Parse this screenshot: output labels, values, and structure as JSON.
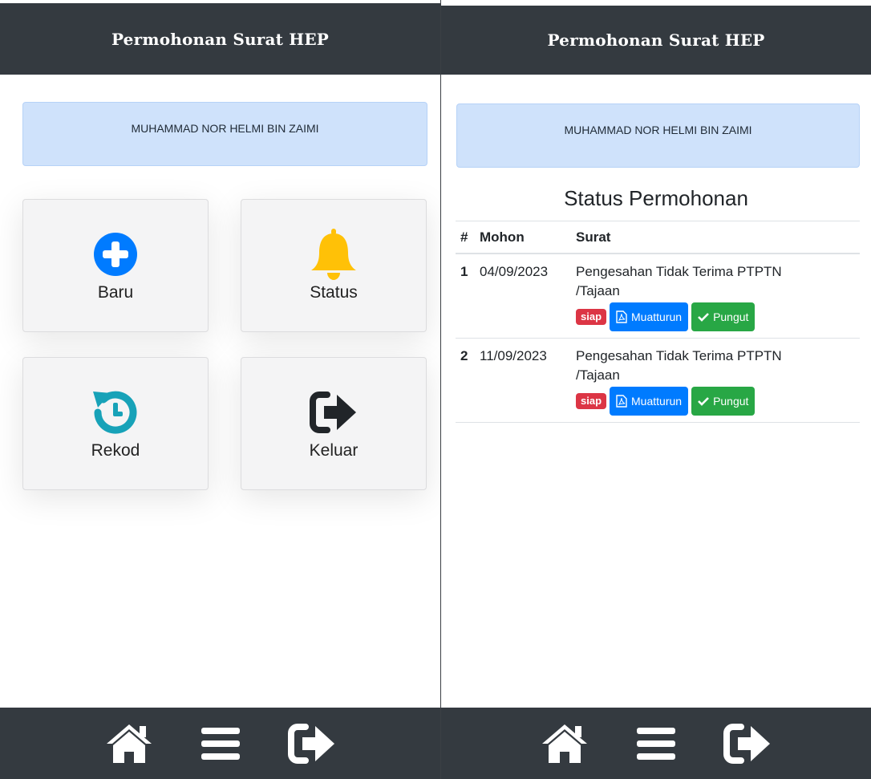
{
  "left": {
    "header": {
      "title": "Permohonan Surat HEP"
    },
    "user": {
      "name": "MUHAMMAD NOR HELMI BIN ZAIMI"
    },
    "tiles": [
      {
        "label": "Baru",
        "icon": "plus-circle-icon",
        "color": "#007bff"
      },
      {
        "label": "Status",
        "icon": "bell-icon",
        "color": "#ffc107"
      },
      {
        "label": "Rekod",
        "icon": "history-icon",
        "color": "#17a2b8"
      },
      {
        "label": "Keluar",
        "icon": "sign-out-icon",
        "color": "#212529"
      }
    ],
    "footer": {
      "icons": [
        "home-icon",
        "menu-icon",
        "sign-out-icon"
      ]
    }
  },
  "right": {
    "header": {
      "title": "Permohonan Surat HEP"
    },
    "user": {
      "name": "MUHAMMAD NOR HELMI BIN ZAIMI"
    },
    "section_title": "Status Permohonan",
    "table": {
      "headers": [
        "#",
        "Mohon",
        "Surat"
      ],
      "rows": [
        {
          "num": "1",
          "date": "04/09/2023",
          "surat_line1": "Pengesahan Tidak Terima PTPTN",
          "surat_line2": "/Tajaan",
          "badge": "siap",
          "download": "Muatturun",
          "collect": "Pungut"
        },
        {
          "num": "2",
          "date": "11/09/2023",
          "surat_line1": "Pengesahan Tidak Terima PTPTN",
          "surat_line2": "/Tajaan",
          "badge": "siap",
          "download": "Muatturun",
          "collect": "Pungut"
        }
      ]
    },
    "footer": {
      "icons": [
        "home-icon",
        "menu-icon",
        "sign-out-icon"
      ]
    }
  },
  "colors": {
    "bar": "#343a40",
    "namebox": "#cfe2fb",
    "badge": "#dc3545",
    "primary": "#007bff",
    "success": "#28a745"
  }
}
